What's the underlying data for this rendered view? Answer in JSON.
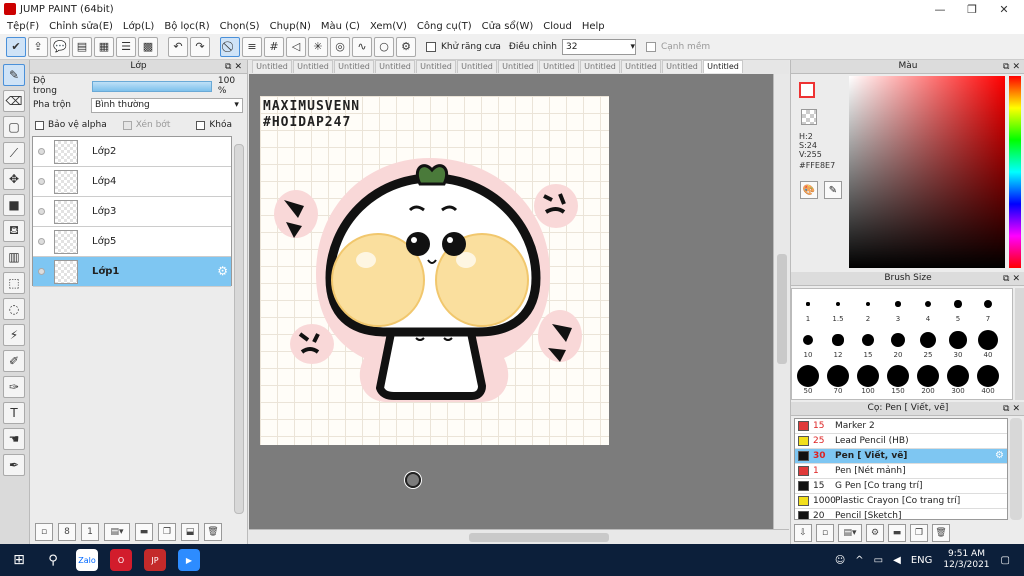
{
  "window": {
    "title": "JUMP PAINT (64bit)",
    "minimize": "—",
    "maximize": "❐",
    "close": "✕"
  },
  "menu": [
    "Tệp(F)",
    "Chỉnh sửa(E)",
    "Lớp(L)",
    "Bộ lọc(R)",
    "Chọn(S)",
    "Chụp(N)",
    "Màu (C)",
    "Xem(V)",
    "Công cụ(T)",
    "Cửa sổ(W)",
    "Cloud",
    "Help"
  ],
  "toolbar": {
    "antialias_label": "Khử răng cưa",
    "correction_label": "Điều chỉnh",
    "correction_value": "32",
    "snap_label": "Cạnh mềm"
  },
  "layer_panel": {
    "title": "Lớp",
    "opacity_label": "Độ trong",
    "opacity_value": "100 %",
    "opacity_fraction": 1.0,
    "blend_label": "Pha trộn",
    "blend_value": "Bình thường",
    "protect_alpha": "Bảo vệ alpha",
    "clipping": "Xén bớt",
    "lock": "Khóa",
    "layers": [
      {
        "name": "Lớp2",
        "selected": false
      },
      {
        "name": "Lớp4",
        "selected": false
      },
      {
        "name": "Lớp3",
        "selected": false
      },
      {
        "name": "Lớp5",
        "selected": false
      },
      {
        "name": "Lớp1",
        "selected": true
      }
    ]
  },
  "doc_tabs": [
    {
      "label": "Untitled",
      "active": false
    },
    {
      "label": "Untitled",
      "active": false
    },
    {
      "label": "Untitled",
      "active": false
    },
    {
      "label": "Untitled",
      "active": false
    },
    {
      "label": "Untitled",
      "active": false
    },
    {
      "label": "Untitled",
      "active": false
    },
    {
      "label": "Untitled",
      "active": false
    },
    {
      "label": "Untitled",
      "active": false
    },
    {
      "label": "Untitled",
      "active": false
    },
    {
      "label": "Untitled",
      "active": false
    },
    {
      "label": "Untitled",
      "active": false
    },
    {
      "label": "Untitled",
      "active": true
    }
  ],
  "canvas": {
    "artist_line1": "MAXIMUSVENN",
    "artist_line2": "#HOIDAP247"
  },
  "color_panel": {
    "title": "Màu",
    "h": "H:2",
    "s": "S:24",
    "v": "V:255",
    "hex": "#FFE8E7",
    "current_color": "#FFE8E7"
  },
  "brush_panel": {
    "title": "Brush Size",
    "sizes": [
      "1",
      "1.5",
      "2",
      "3",
      "4",
      "5",
      "7",
      "10",
      "12",
      "15",
      "20",
      "25",
      "30",
      "40",
      "50",
      "70",
      "100",
      "150",
      "200",
      "300",
      "400"
    ]
  },
  "tool_panel": {
    "title": "Cọ: Pen [ Viết, vẽ]",
    "tools": [
      {
        "size": "15",
        "name": "Marker 2",
        "color": "#e03a3a",
        "size_red": true,
        "selected": false
      },
      {
        "size": "25",
        "name": "Lead Pencil (HB)",
        "color": "#f2df1c",
        "size_red": true,
        "selected": false
      },
      {
        "size": "30",
        "name": "Pen [ Viết, vẽ]",
        "color": "#111111",
        "size_red": true,
        "selected": true
      },
      {
        "size": "1",
        "name": "Pen [Nét mảnh]",
        "color": "#e03a3a",
        "size_red": true,
        "selected": false
      },
      {
        "size": "15",
        "name": "G Pen [Co trang trí]",
        "color": "#111111",
        "size_red": false,
        "selected": false
      },
      {
        "size": "1000",
        "name": "Plastic Crayon [Co trang trí]",
        "color": "#f2df1c",
        "size_red": false,
        "selected": false
      },
      {
        "size": "20",
        "name": "Pencil [Sketch]",
        "color": "#111111",
        "size_red": false,
        "selected": false
      }
    ]
  },
  "taskbar": {
    "apps": [
      {
        "name": "Zalo",
        "color": "#ffffff",
        "text": "Zalo"
      },
      {
        "name": "Opera",
        "color": "#d21c2c",
        "text": "O"
      },
      {
        "name": "Jump Paint",
        "color": "#c42a2a",
        "text": "JP"
      },
      {
        "name": "Zoom",
        "color": "#2d8cff",
        "text": "▶"
      }
    ],
    "lang": "ENG",
    "time": "9:51 AM",
    "date": "12/3/2021"
  }
}
